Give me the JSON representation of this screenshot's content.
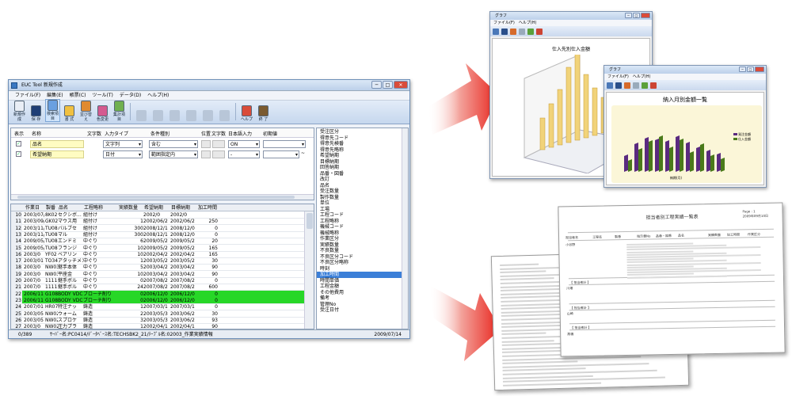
{
  "main_window": {
    "title": "EUC Tool 新規作成",
    "controls": {
      "minimize": "─",
      "maximize": "□",
      "close": "✕"
    },
    "menu": [
      "ファイル(F)",
      "編集(E)",
      "帳票(C)",
      "ツール(T)",
      "データ(D)",
      "ヘルプ(H)"
    ],
    "toolbar": [
      {
        "label": "新規作成",
        "icon": "new-doc-icon",
        "enabled": true
      },
      {
        "label": "保 存",
        "icon": "save-icon",
        "enabled": true
      },
      {
        "label": "検索項目",
        "icon": "search-fields-icon",
        "enabled": true,
        "selected": true
      },
      {
        "label": "書 式",
        "icon": "format-icon",
        "enabled": true
      },
      {
        "label": "並び替え",
        "icon": "sort-icon",
        "enabled": true
      },
      {
        "label": "色変更",
        "icon": "color-icon",
        "enabled": true
      },
      {
        "label": "集計項目",
        "icon": "aggregate-icon",
        "enabled": true
      },
      {
        "label": "",
        "icon": "disabled-icon",
        "enabled": false
      },
      {
        "label": "",
        "icon": "disabled-icon",
        "enabled": false
      },
      {
        "label": "",
        "icon": "disabled-icon",
        "enabled": false
      },
      {
        "label": "",
        "icon": "disabled-icon",
        "enabled": false
      },
      {
        "label": "",
        "icon": "disabled-icon",
        "enabled": false
      },
      {
        "label": "",
        "icon": "disabled-icon",
        "enabled": false
      },
      {
        "label": "ヘルプ",
        "icon": "help-icon",
        "enabled": true
      },
      {
        "label": "終 了",
        "icon": "exit-icon",
        "enabled": true
      }
    ],
    "condition_headers": [
      "表示",
      "名称",
      "文字数",
      "入力タイプ",
      "条件種別",
      "位置",
      "文字数",
      "日本語入力",
      "初期値"
    ],
    "conditions": [
      {
        "checked": true,
        "name": "品名",
        "input_type": "文字列",
        "condition": "含む",
        "ime": "ON",
        "initial": ""
      },
      {
        "checked": true,
        "name": "希望納期",
        "input_type": "日付",
        "condition": "範囲指定内",
        "ime": "-",
        "initial": ""
      }
    ],
    "range_sep": "~",
    "grid_headers": [
      "作業日",
      "製番",
      "品名",
      "工程略称",
      "実績数量",
      "希望納期",
      "目標納期",
      "加工時間"
    ],
    "grid_rows": [
      {
        "no": "10",
        "date": "2003/07/0",
        "serial": "8K02",
        "name": "セクシボ...",
        "proc": "組付け",
        "qty": "",
        "req": "2002/0",
        "target": "2002/0",
        "time": "",
        "hl": false
      },
      {
        "no": "11",
        "date": "2003/09/0",
        "serial": "GK02",
        "name": "マウス用",
        "proc": "組付け",
        "qty": "1",
        "req": "2002/06/2",
        "target": "2002/06/2",
        "time": "250",
        "hl": false
      },
      {
        "no": "12",
        "date": "2003/11/0",
        "serial": "TU08",
        "name": "バルブセ",
        "proc": "組付け",
        "qty": "300",
        "req": "2008/12/1",
        "target": "2008/12/0",
        "time": "0",
        "hl": false
      },
      {
        "no": "13",
        "date": "2003/11/0",
        "serial": "TU08",
        "name": "マル",
        "proc": "組付け",
        "qty": "300",
        "req": "2008/12/1",
        "target": "2008/12/0",
        "time": "0",
        "hl": false
      },
      {
        "no": "14",
        "date": "2009/05/0",
        "serial": "TU08",
        "name": "エンドミ",
        "proc": "中ぐり",
        "qty": "6",
        "req": "2009/05/2",
        "target": "2009/05/2",
        "time": "20",
        "hl": false
      },
      {
        "no": "15",
        "date": "2009/05/0",
        "serial": "TU08",
        "name": "フランジ",
        "proc": "中ぐり",
        "qty": "10",
        "req": "2009/05/2",
        "target": "2009/05/2",
        "time": "165",
        "hl": false
      },
      {
        "no": "16",
        "date": "2003/0",
        "serial": "YF02",
        "name": "ベアリン",
        "proc": "中ぐり",
        "qty": "10",
        "req": "2002/04/2",
        "target": "2002/04/2",
        "time": "165",
        "hl": false
      },
      {
        "no": "17",
        "date": "2003/01",
        "serial": "TO34",
        "name": "アタッチメントM",
        "proc": "中ぐり",
        "qty": "1",
        "req": "2003/05/2",
        "target": "2003/05/2",
        "time": "30",
        "hl": false
      },
      {
        "no": "18",
        "date": "2003/0",
        "serial": "NW03",
        "name": "継手本体",
        "proc": "中ぐり",
        "qty": "5",
        "req": "2003/04/2",
        "target": "2003/04/2",
        "time": "90",
        "hl": false
      },
      {
        "no": "19",
        "date": "2003/0",
        "serial": "NW03",
        "name": "平座金",
        "proc": "中ぐり",
        "qty": "10",
        "req": "2003/04/2",
        "target": "2003/04/2",
        "time": "90",
        "hl": false
      },
      {
        "no": "20",
        "date": "2007/0",
        "serial": "1111",
        "name": "継手ボル",
        "proc": "中ぐり",
        "qty": "0",
        "req": "2007/08/2",
        "target": "2007/08/2",
        "time": "0",
        "hl": false
      },
      {
        "no": "21",
        "date": "2007/0",
        "serial": "1111",
        "name": "継手ボル",
        "proc": "中ぐり",
        "qty": "24",
        "req": "2007/08/2",
        "target": "2007/08/2",
        "time": "600",
        "hl": false
      },
      {
        "no": "22",
        "date": "2006/11",
        "serial": "G108",
        "name": "BODY VDC",
        "proc": "ブローチ削り",
        "qty": "0",
        "req": "2006/12/0",
        "target": "2006/12/0",
        "time": "0",
        "hl": true
      },
      {
        "no": "23",
        "date": "2006/11",
        "serial": "G108",
        "name": "BODY VDC",
        "proc": "ブローチ削り",
        "qty": "0",
        "req": "2006/12/0",
        "target": "2006/12/0",
        "time": "0",
        "hl": true
      },
      {
        "no": "24",
        "date": "2007/01",
        "serial": "HR07",
        "name": "特注ナッ",
        "proc": "鋳造",
        "qty": "1",
        "req": "2007/03/1",
        "target": "2007/03/1",
        "time": "0",
        "hl": false
      },
      {
        "no": "25",
        "date": "2003/05",
        "serial": "NW02",
        "name": "ウォーム",
        "proc": "鋳造",
        "qty": "2",
        "req": "2003/05/3",
        "target": "2003/06/2",
        "time": "30",
        "hl": false
      },
      {
        "no": "26",
        "date": "2003/05",
        "serial": "NW02",
        "name": "スプロケ",
        "proc": "鋳造",
        "qty": "3",
        "req": "2003/05/3",
        "target": "2003/06/2",
        "time": "93",
        "hl": false
      },
      {
        "no": "27",
        "date": "2003/0",
        "serial": "NW02",
        "name": "圧力プラ",
        "proc": "鋳造",
        "qty": "1",
        "req": "2002/04/1",
        "target": "2002/04/1",
        "time": "90",
        "hl": false
      }
    ],
    "status": {
      "count": "0/389",
      "info": "ｻｰﾊﾞｰ名:PC0414/ﾃﾞｰﾀﾍﾞｰｽ名:TECHSBK2_21/ﾃｰﾌﾞﾙ名:02003_作業実績情報",
      "date": "2009/07/14"
    },
    "fields": [
      "受注区分",
      "得意先コード",
      "得意先検番",
      "得意先略称",
      "希望納期",
      "目標納期",
      "回答納期",
      "品番・図番",
      "改訂",
      "品名",
      "受注数量",
      "製作数量",
      "単位",
      "工場",
      "工程コード",
      "工程略称",
      "機械コード",
      "機械略称",
      "作業区分",
      "実績数量",
      "不良数量",
      "不良区分コード",
      "不良区分略称",
      "時刻",
      "加工時間",
      "時間単価",
      "工程金額",
      "その他費用",
      "備考",
      "管理No",
      "受注日付"
    ],
    "selected_field": "加工時間"
  },
  "graph_window_1": {
    "title": "グラフ",
    "menu": [
      "ファイル(F)",
      "ヘルプ(H)"
    ],
    "toolbar": [
      "印刷",
      "保存",
      "グラフ",
      "",
      "ヘルプ",
      "終了"
    ],
    "chart_title": "仕入先別仕入金額"
  },
  "graph_window_2": {
    "title": "グラフ",
    "menu": [
      "ファイル(F)",
      "ヘルプ(H)"
    ],
    "toolbar": [
      "印刷",
      "保存",
      "グラフ",
      "",
      "ヘルプ",
      "終了"
    ],
    "chart_title": "納入月別金額一覧",
    "legend": [
      "発注金額",
      "仕入金額"
    ],
    "x_label": "納期(月)"
  },
  "report_front": {
    "title": "担当者別工程実績一覧表",
    "page": "Page : 1",
    "print_date": "2009年09月10日",
    "header_fields": [
      "担当者名",
      "工程名",
      "製番",
      "指示書No",
      "品番・図番",
      "品名",
      "実績数量",
      "加工時間",
      "作業区分"
    ],
    "subtotals": [
      "【 担当者計 】",
      "【 担当者計 】",
      "【 担当者計 】"
    ],
    "sections": [
      "小谷野",
      "川畑",
      "山崎",
      "高橋"
    ]
  },
  "colors": {
    "accent": "#3b7fd8",
    "highlight": "#27d727",
    "yellow_field": "#fffcc2",
    "arrow": "#e8231b"
  }
}
